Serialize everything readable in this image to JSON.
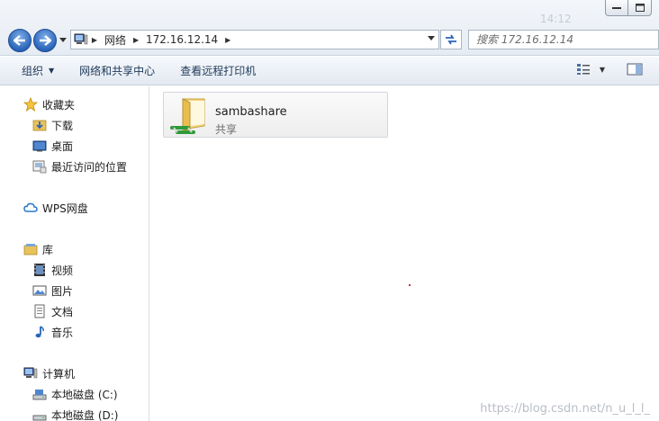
{
  "titlebar": {
    "ghost_text": "14:12"
  },
  "address": {
    "crumbs": [
      "网络",
      "172.16.12.14"
    ]
  },
  "search": {
    "placeholder": "搜索 172.16.12.14"
  },
  "commandbar": {
    "organize": "组织",
    "network_sharing": "网络和共享中心",
    "remote_printers": "查看远程打印机"
  },
  "sidebar": {
    "favorites": "收藏夹",
    "downloads": "下载",
    "desktop": "桌面",
    "recent": "最近访问的位置",
    "wps": "WPS网盘",
    "libraries": "库",
    "videos": "视频",
    "pictures": "图片",
    "documents": "文档",
    "music": "音乐",
    "computer": "计算机",
    "disk_c": "本地磁盘 (C:)",
    "disk_d": "本地磁盘 (D:)"
  },
  "content": {
    "share_name": "sambashare",
    "share_type": "共享"
  },
  "watermark": "https://blog.csdn.net/n_u_l_l_",
  "colors": {
    "accent": "#1e395b",
    "nav_blue": "#2a64b8",
    "folder": "#f2c94c"
  }
}
